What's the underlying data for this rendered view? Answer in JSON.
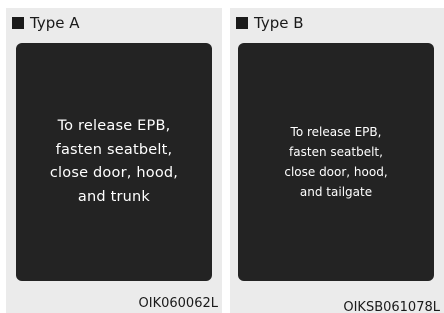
{
  "panels": [
    {
      "title": "Type A",
      "message": [
        "To release EPB,",
        "fasten seatbelt,",
        "close door, hood,",
        "and trunk"
      ],
      "code": "OIK060062L"
    },
    {
      "title": "Type B",
      "message": [
        "To release EPB,",
        "fasten seatbelt,",
        "close door, hood,",
        "and tailgate"
      ],
      "code": "OIKSB061078L"
    }
  ],
  "colors": {
    "panel_background": "#ebebeb",
    "screen_background": "#232323",
    "screen_text": "#ffffff",
    "bullet": "#1a1a1a"
  },
  "icons": {
    "bullet": "black-square-bullet-icon"
  }
}
